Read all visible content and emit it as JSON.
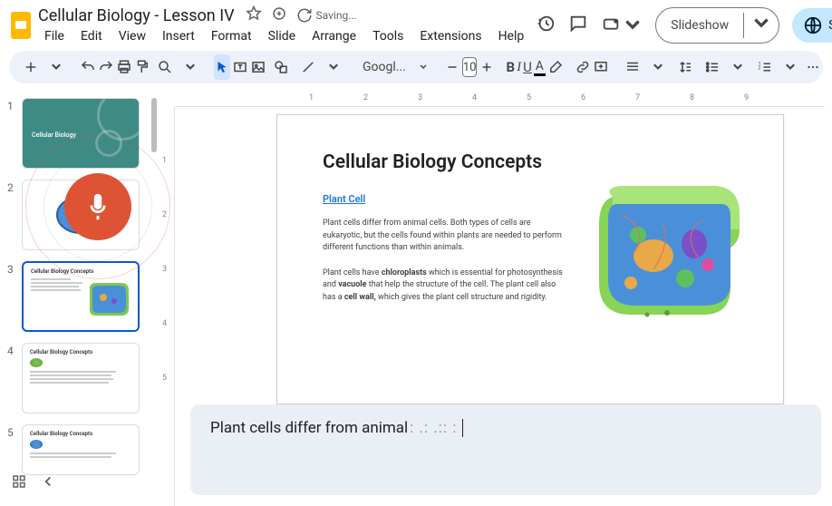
{
  "header": {
    "title": "Cellular Biology - Lesson IV",
    "saving": "Saving...",
    "menu": [
      "File",
      "Edit",
      "View",
      "Insert",
      "Format",
      "Slide",
      "Arrange",
      "Tools",
      "Extensions",
      "Help"
    ],
    "slideshow_label": "Slideshow",
    "share_label": "Sha"
  },
  "toolbar": {
    "font_name": "Googl...",
    "font_size": "10"
  },
  "ruler_h": [
    "1",
    "2",
    "3",
    "4",
    "5",
    "6",
    "7",
    "8",
    "9"
  ],
  "ruler_v": [
    "1",
    "2",
    "3",
    "4",
    "5"
  ],
  "filmstrip": {
    "thumbs": [
      {
        "num": "1",
        "title": "Cellular Biology"
      },
      {
        "num": "2",
        "title": ""
      },
      {
        "num": "3",
        "title": "Cellular Biology Concepts"
      },
      {
        "num": "4",
        "title": "Cellular Biology Concepts"
      },
      {
        "num": "5",
        "title": "Cellular Biology Concepts"
      }
    ]
  },
  "slide": {
    "title": "Cellular Biology Concepts",
    "subtitle": "Plant Cell",
    "p1": "Plant cells differ from animal cells. Both types of cells are eukaryotic, but the cells found within plants are needed to perform different functions than within animals.",
    "p2_a": "Plant cells have ",
    "p2_b": "chloroplasts",
    "p2_c": " which is essential for photosynthesis and ",
    "p2_d": "vacuole",
    "p2_e": " that help the structure of the cell. The plant cell also has a ",
    "p2_f": "cell wall,",
    "p2_g": " which gives the plant cell structure and rigidity."
  },
  "caption": {
    "text": "Plant cells differ from animal",
    "suffix": ": .: .:: :"
  },
  "icons": {
    "star": "star-icon",
    "move": "move-to-folder-icon",
    "cloud": "cloud-save-icon",
    "history": "history-icon",
    "comment": "comment-icon",
    "present": "present-icon",
    "globe": "globe-icon",
    "mic": "microphone-icon"
  }
}
